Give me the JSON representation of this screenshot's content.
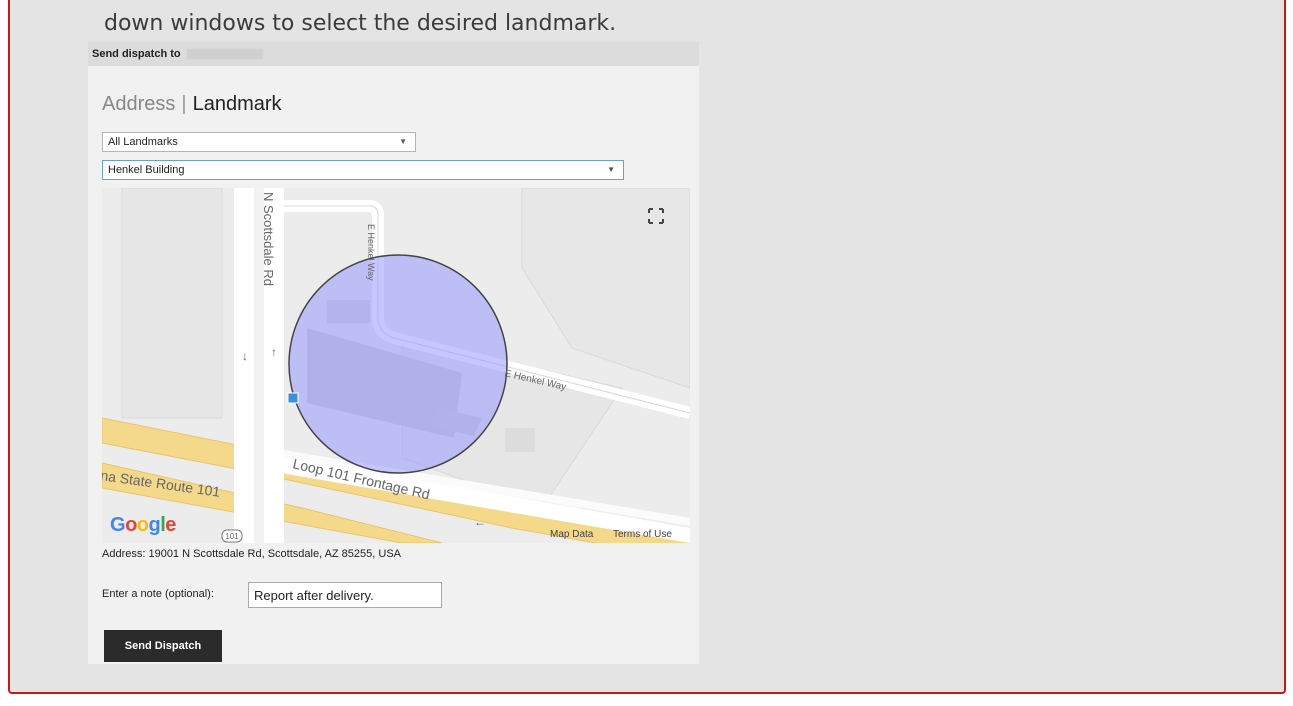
{
  "intro_text": "down windows to select the desired landmark.",
  "dialog": {
    "header_label": "Send dispatch to",
    "tabs": {
      "inactive": "Address",
      "separator": "|",
      "active": "Landmark"
    },
    "landmark_category": {
      "value": "All Landmarks"
    },
    "landmark": {
      "value": "Henkel Building"
    },
    "map": {
      "streets": {
        "scottsdale": "N Scottsdale Rd",
        "henkel_vertical": "E Henkel Way",
        "henkel_horizontal": "E Henkel Way",
        "loop_frontage": "Loop 101 Frontage Rd",
        "state_route": "na State Route 101",
        "shield": "101"
      },
      "logo": "Google",
      "map_data_label": "Map Data",
      "terms_label": "Terms of Use",
      "fullscreen_icon": "fullscreen-icon",
      "geofence_color": "#b7b7f5"
    },
    "address_line": "Address: 19001 N Scottsdale Rd, Scottsdale, AZ 85255, USA",
    "note": {
      "label": "Enter a note (optional):",
      "value": "Report after delivery."
    },
    "send_button": "Send Dispatch"
  },
  "colors": {
    "frame_border": "#c41a1a",
    "button_bg": "#2b2b2b",
    "highway": "#f5d98a"
  }
}
